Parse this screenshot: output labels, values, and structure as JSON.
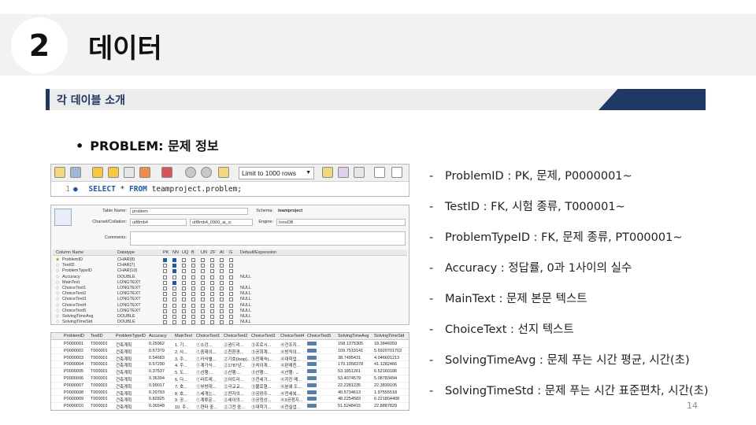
{
  "header": {
    "section_number": "2",
    "title": "데이터"
  },
  "subtitle": "각 데이블 소개",
  "bullet": {
    "marker": "•",
    "text": "PROBLEM: 문제 정보"
  },
  "descriptions": [
    "ProblemID : PK, 문제, P0000001~",
    "TestID : FK, 시험 종류, T000001~",
    "ProblemTypeID : FK, 문제 종류, PT000001~",
    "Accuracy : 정답률, 0과 1사이의 실수",
    "MainText : 문제 본문 텍스트",
    "ChoiceText : 선지 텍스트",
    "SolvingTimeAvg : 문제 푸는 시간 평균, 시간(초)",
    "SolvingTimeStd : 문제 푸는 시간 표준편차, 시간(초)"
  ],
  "desc_dash": "-",
  "page_number": "14",
  "query_editor": {
    "limit_label": "Limit to 1000 rows",
    "line_number": "1",
    "kw_select": "SELECT",
    "kw_from": "FROM",
    "star": "*",
    "table_ref": "teamproject.problem;"
  },
  "table_editor": {
    "table_name_label": "Table Name:",
    "table_name": "problem",
    "schema_label": "Schema:",
    "schema": "teamproject",
    "charset_label": "Charset/Collation:",
    "charset": "utf8mb4",
    "collation": "utf8mb4_0900_ai_ci",
    "engine_label": "Engine:",
    "engine": "InnoDB",
    "comments_label": "Comments:",
    "headers": [
      "Column Name",
      "Datatype",
      "PK",
      "NN",
      "UQ",
      "B",
      "UN",
      "ZF",
      "AI",
      "G",
      "Default/Expression"
    ],
    "columns": [
      {
        "name": "ProblemID",
        "type": "CHAR(8)",
        "pk": true,
        "nn": true,
        "default": ""
      },
      {
        "name": "TestID",
        "type": "CHAR(7)",
        "pk": false,
        "nn": true,
        "default": ""
      },
      {
        "name": "ProblemTypeID",
        "type": "CHAR(10)",
        "pk": false,
        "nn": true,
        "default": ""
      },
      {
        "name": "Accuracy",
        "type": "DOUBLE",
        "pk": false,
        "nn": false,
        "default": "NULL"
      },
      {
        "name": "MainText",
        "type": "LONGTEXT",
        "pk": false,
        "nn": true,
        "default": ""
      },
      {
        "name": "ChoiceText1",
        "type": "LONGTEXT",
        "pk": false,
        "nn": false,
        "default": "NULL"
      },
      {
        "name": "ChoiceText2",
        "type": "LONGTEXT",
        "pk": false,
        "nn": false,
        "default": "NULL"
      },
      {
        "name": "ChoiceText3",
        "type": "LONGTEXT",
        "pk": false,
        "nn": false,
        "default": "NULL"
      },
      {
        "name": "ChoiceText4",
        "type": "LONGTEXT",
        "pk": false,
        "nn": false,
        "default": "NULL"
      },
      {
        "name": "ChoiceText5",
        "type": "LONGTEXT",
        "pk": false,
        "nn": false,
        "default": "NULL"
      },
      {
        "name": "SolvingTimeAvg",
        "type": "DOUBLE",
        "pk": false,
        "nn": false,
        "default": "NULL"
      },
      {
        "name": "SolvingTimeStd",
        "type": "DOUBLE",
        "pk": false,
        "nn": false,
        "default": "NULL"
      }
    ]
  },
  "results": {
    "headers": [
      "ProblemID",
      "TestID",
      "ProblemTypeID",
      "Accuracy",
      "MainText",
      "ChoiceText1",
      "ChoiceText2",
      "ChoiceText3",
      "ChoiceText4",
      "ChoiceText5",
      "SolvingTimeAvg",
      "SolvingTimeStd"
    ],
    "rows": [
      [
        "P0000001",
        "T000001",
        "건축계획",
        "0.25962",
        "1. 기...",
        "①소강...",
        "②권드리...",
        "③프로시...",
        "④건조지...",
        "BLOB",
        "158.1375305",
        "18.3846059"
      ],
      [
        "P0000002",
        "T000001",
        "건축계획",
        "0.67379",
        "2. 사...",
        "①중재이...",
        "②친환경...",
        "③공회계...",
        "④방직이...",
        "BLOB",
        "109.7519141",
        "5.5920701702"
      ],
      [
        "P0000003",
        "T000001",
        "건축계획",
        "0.54683",
        "3. 주...",
        "①카식별...",
        "②기호(loop)...",
        "③전제숙(...",
        "④대학업...",
        "BLOB",
        "38.7495431",
        "4.046601213"
      ],
      [
        "P0000004",
        "T000001",
        "건축계획",
        "0.57290",
        "4. 주...",
        "①계가식...",
        "②1787년...",
        "③치이계...",
        "④판레친...",
        "BLOB",
        "170.1958378",
        "41.1282466"
      ],
      [
        "P0000005",
        "T000001",
        "건축계획",
        "0.37537",
        "5. 도...",
        "①선행:...",
        "②산행:...",
        "③산행:...",
        "④산행: ↔",
        "BLOB",
        "53.1851261",
        "6.52160186"
      ],
      [
        "P0000006",
        "T000001",
        "건축계획",
        "0.36394",
        "6. 다...",
        "①라트레...",
        "②아트라...",
        "③전세기...",
        "④지진 메...",
        "BLOB",
        "53.4074579",
        "5.08783494"
      ],
      [
        "P0000007",
        "T000001",
        "건축계획",
        "0.99017",
        "7. 호...",
        "①부방대...",
        "②극교교...",
        "③불로형...",
        "④분쇄 도...",
        "BLOB",
        "22.2281235",
        "22.3839105"
      ],
      [
        "P0000008",
        "T000001",
        "건축계획",
        "0.20793",
        "8. 호...",
        "①세개는...",
        "②전자의...",
        "③공장주...",
        "④전세복...",
        "BLOB",
        "40.5734613",
        "1.97555518"
      ],
      [
        "P0000009",
        "T000001",
        "건축계획",
        "0.82825",
        "9. 공...",
        "①계류문...",
        "②세이의...",
        "③공정상...",
        "④3공정지...",
        "BLOB",
        "48.2254583",
        "6.221804408"
      ],
      [
        "P0000010",
        "T000001",
        "건축계획",
        "0.36548",
        "10. 주...",
        "①현터 중...",
        "②그전 중...",
        "③대학기...",
        "④전실업...",
        "BLOB",
        "51.5248415",
        "22.8887829"
      ]
    ]
  }
}
